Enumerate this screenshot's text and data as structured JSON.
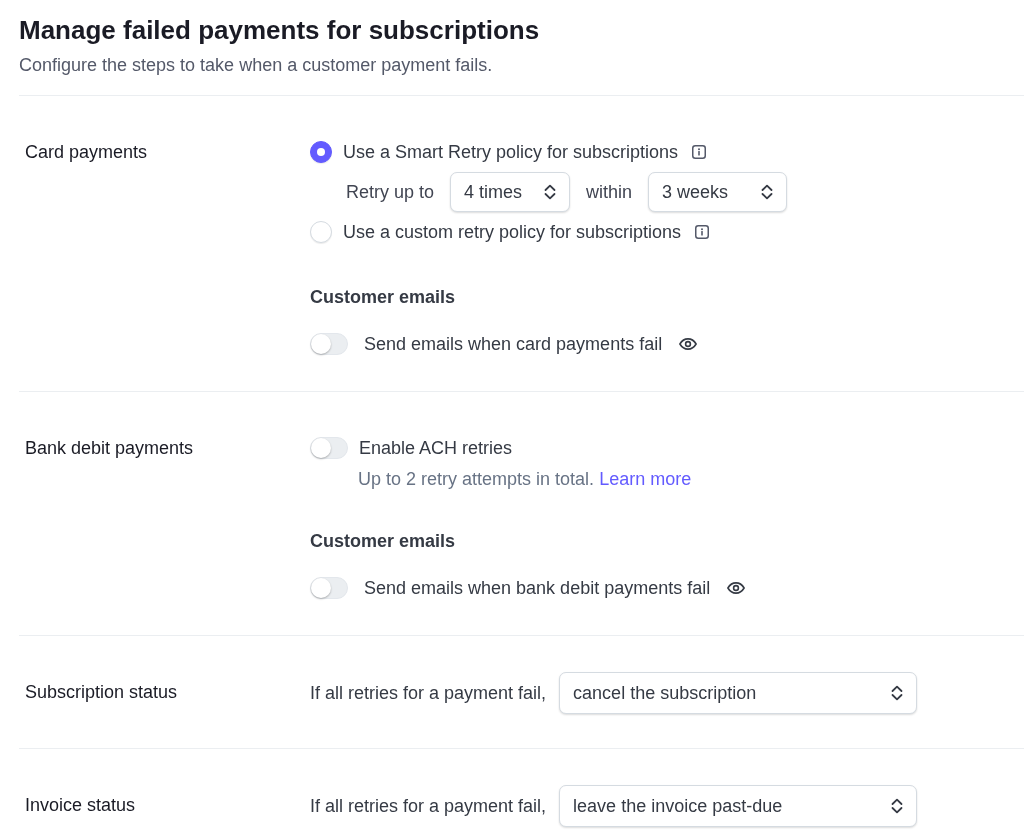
{
  "header": {
    "title": "Manage failed payments for subscriptions",
    "subtitle": "Configure the steps to take when a customer payment fails."
  },
  "sections": [
    {
      "label": "Card payments",
      "items": [
        {
          "kind": "radio",
          "label": "Use a Smart Retry policy for subscriptions",
          "selected": true
        },
        {
          "kind": "retry_row",
          "prefix": "Retry up to",
          "count": "4 times",
          "joiner": "within",
          "period": "3 weeks"
        },
        {
          "kind": "radio",
          "label": "Use a custom retry policy for subscriptions",
          "selected": false
        },
        {
          "kind": "heading",
          "text": "Customer emails"
        },
        {
          "kind": "email_toggle",
          "label": "Send emails when card payments fail",
          "on": false
        }
      ]
    },
    {
      "label": "Bank debit payments",
      "items": [
        {
          "kind": "toggle",
          "label": "Enable ACH retries",
          "on": false,
          "description": "Up to 2 retry attempts in total.",
          "link": "Learn more"
        },
        {
          "kind": "heading",
          "text": "Customer emails"
        },
        {
          "kind": "email_toggle",
          "label": "Send emails when bank debit payments fail",
          "on": false
        }
      ]
    },
    {
      "label": "Subscription status",
      "items": [
        {
          "kind": "select_row",
          "prompt": "If all retries for a payment fail,",
          "value": "cancel the subscription"
        }
      ]
    },
    {
      "label": "Invoice status",
      "items": [
        {
          "kind": "select_row",
          "prompt": "If all retries for a payment fail,",
          "value": "leave the invoice past-due"
        }
      ]
    }
  ]
}
